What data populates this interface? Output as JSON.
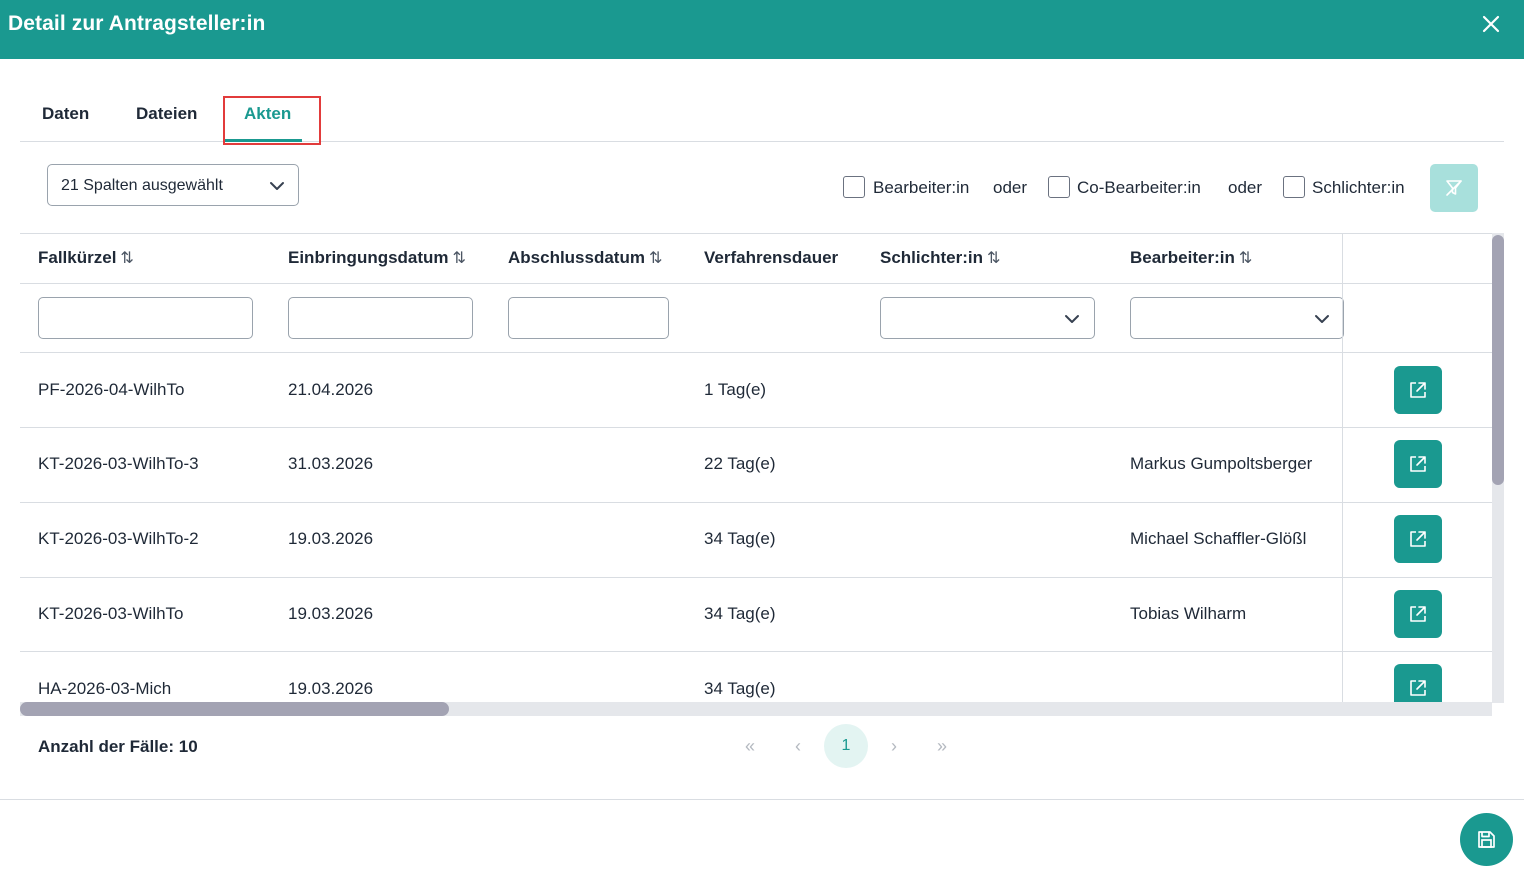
{
  "dialog": {
    "title": "Detail zur Antragsteller:in"
  },
  "tabs": [
    {
      "label": "Daten"
    },
    {
      "label": "Dateien"
    },
    {
      "label": "Akten",
      "active": true
    }
  ],
  "toolbar": {
    "column_select_value": "21 Spalten ausgewählt",
    "checkboxes": [
      {
        "label": "Bearbeiter:in",
        "checked": false
      },
      {
        "label": "Co-Bearbeiter:in",
        "checked": false
      },
      {
        "label": "Schlichter:in",
        "checked": false
      }
    ],
    "connector": "oder",
    "filter_icon": "filter-off-icon"
  },
  "table": {
    "columns": [
      {
        "label": "Fallkürzel",
        "sortable": true
      },
      {
        "label": "Einbringungsdatum",
        "sortable": true
      },
      {
        "label": "Abschlussdatum",
        "sortable": true
      },
      {
        "label": "Verfahrensdauer",
        "sortable": false
      },
      {
        "label": "Schlichter:in",
        "sortable": true
      },
      {
        "label": "Bearbeiter:in",
        "sortable": true
      }
    ],
    "sort_glyph": "⇅",
    "rows": [
      {
        "fallkuerzel": "PF-2026-04-WilhTo",
        "einbringungsdatum": "21.04.2026",
        "abschlussdatum": "",
        "verfahrensdauer": "1 Tag(e)",
        "schlichter": "",
        "bearbeiter": ""
      },
      {
        "fallkuerzel": "KT-2026-03-WilhTo-3",
        "einbringungsdatum": "31.03.2026",
        "abschlussdatum": "",
        "verfahrensdauer": "22 Tag(e)",
        "schlichter": "",
        "bearbeiter": "Markus Gumpoltsberger"
      },
      {
        "fallkuerzel": "KT-2026-03-WilhTo-2",
        "einbringungsdatum": "19.03.2026",
        "abschlussdatum": "",
        "verfahrensdauer": "34 Tag(e)",
        "schlichter": "",
        "bearbeiter": "Michael Schaffler-Glößl"
      },
      {
        "fallkuerzel": "KT-2026-03-WilhTo",
        "einbringungsdatum": "19.03.2026",
        "abschlussdatum": "",
        "verfahrensdauer": "34 Tag(e)",
        "schlichter": "",
        "bearbeiter": "Tobias Wilharm"
      },
      {
        "fallkuerzel": "HA-2026-03-Mich",
        "einbringungsdatum": "19.03.2026",
        "abschlussdatum": "",
        "verfahrensdauer": "34 Tag(e)",
        "schlichter": "",
        "bearbeiter": ""
      }
    ]
  },
  "footer": {
    "count_label": "Anzahl der Fälle: 10",
    "pagination": {
      "first": "«",
      "prev": "‹",
      "current": "1",
      "next": "›",
      "last": "»"
    }
  },
  "colors": {
    "primary": "#1a9990",
    "primary_light": "#a8e0dc",
    "highlight": "#e23b3b"
  }
}
